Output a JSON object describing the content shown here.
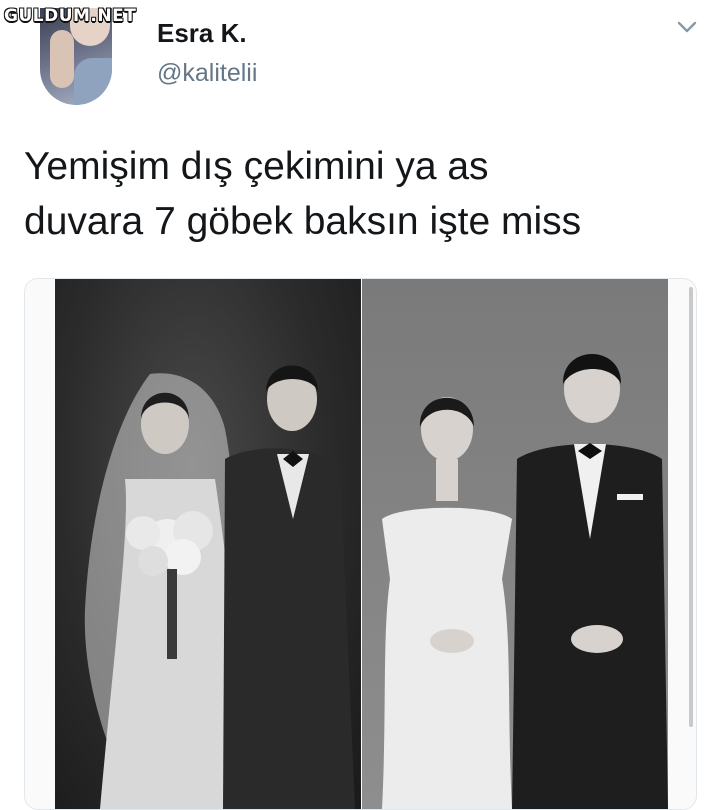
{
  "watermark": {
    "text": "GULDUM.NET"
  },
  "tweet": {
    "author": {
      "display_name": "Esra K.",
      "handle": "@kalitelii"
    },
    "menu_icon": "chevron-down-icon",
    "text": "Yemişim dış çekimini ya as\nduvara 7 göbek baksın işte miss"
  },
  "media": {
    "left_photo": "black-and-white vintage wedding portrait (bride with veil and bouquet, groom in tuxedo)",
    "right_photo": "black-and-white modern wedding portrait (seated bride and groom)"
  }
}
